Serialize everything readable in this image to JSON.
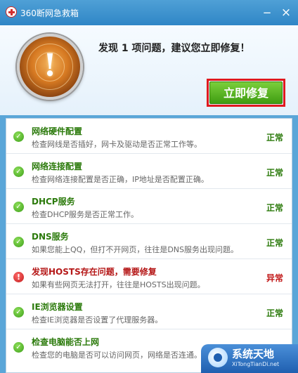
{
  "window": {
    "title": "360断网急救箱",
    "minimize": "−",
    "close": "×"
  },
  "header": {
    "headline": "发现 1 项问题，建议您立即修复！",
    "fix_button": "立即修复"
  },
  "checks": [
    {
      "title": "网络硬件配置",
      "desc": "检查网线是否插好，网卡及驱动是否正常工作等。",
      "status": "正常",
      "state": "ok"
    },
    {
      "title": "网络连接配置",
      "desc": "检查网络连接配置是否正确，IP地址是否配置正确。",
      "status": "正常",
      "state": "ok"
    },
    {
      "title": "DHCP服务",
      "desc": "检查DHCP服务是否正常工作。",
      "status": "正常",
      "state": "ok"
    },
    {
      "title": "DNS服务",
      "desc": "如果您能上QQ，但打不开网页，往往是DNS服务出现问题。",
      "status": "正常",
      "state": "ok"
    },
    {
      "title": "发现HOSTS存在问题，需要修复",
      "desc": "如果有些网页无法打开，往往是HOSTS出现问题。",
      "status": "异常",
      "state": "warn"
    },
    {
      "title": "IE浏览器设置",
      "desc": "检查IE浏览器是否设置了代理服务器。",
      "status": "正常",
      "state": "ok"
    },
    {
      "title": "检查电脑能否上网",
      "desc": "检查您的电脑是否可以访问网页，网络是否连通。",
      "status": "",
      "state": "ok"
    }
  ],
  "watermark": {
    "title": "系统天地",
    "url": "XiTongTianDi.net"
  }
}
